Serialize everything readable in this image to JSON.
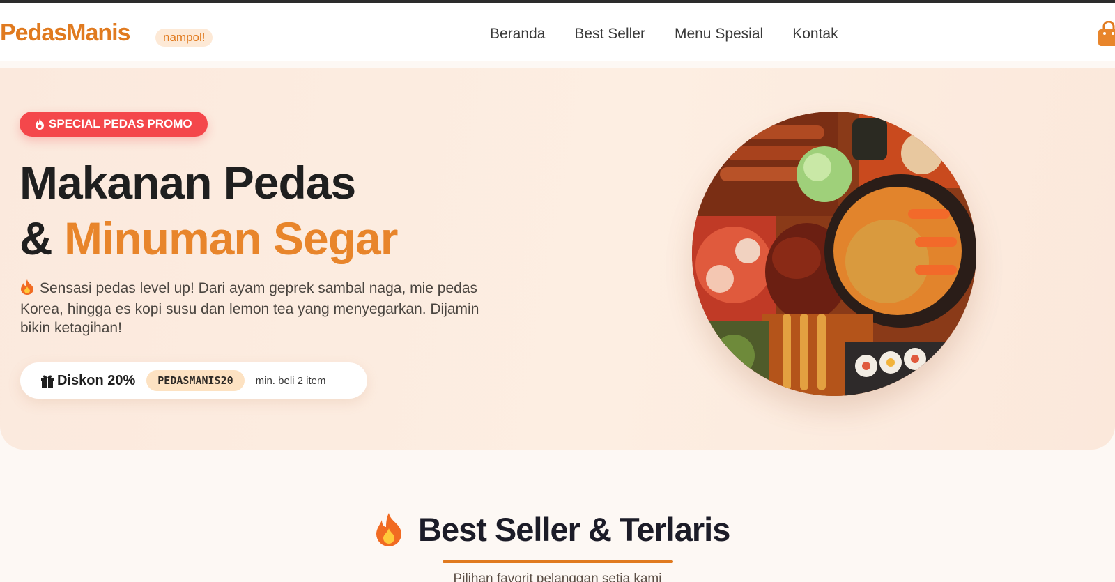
{
  "header": {
    "logo": "PedasManis",
    "logo_badge": "nampol!",
    "nav": [
      "Beranda",
      "Best Seller",
      "Menu Spesial",
      "Kontak"
    ],
    "cart_icon": "shopping-bag-icon"
  },
  "hero": {
    "promo_badge": "SPECIAL PEDAS PROMO",
    "title_line1": "Makanan Pedas",
    "title_amp": "&",
    "title_accent": "Minuman Segar",
    "description": "Sensasi pedas level up! Dari ayam geprek sambal naga, mie pedas Korea, hingga es kopi susu dan lemon tea yang menyegarkan. Dijamin bikin ketagihan!",
    "coupon": {
      "label": "Diskon 20%",
      "code": "PEDASMANIS20",
      "note": "min. beli 2 item"
    }
  },
  "best_seller": {
    "title": "Best Seller & Terlaris",
    "subtitle": "Pilihan favorit pelanggan setia kami"
  },
  "colors": {
    "brand": "#e07a1f",
    "promo": "#f4474b",
    "accent": "#e8852b"
  }
}
